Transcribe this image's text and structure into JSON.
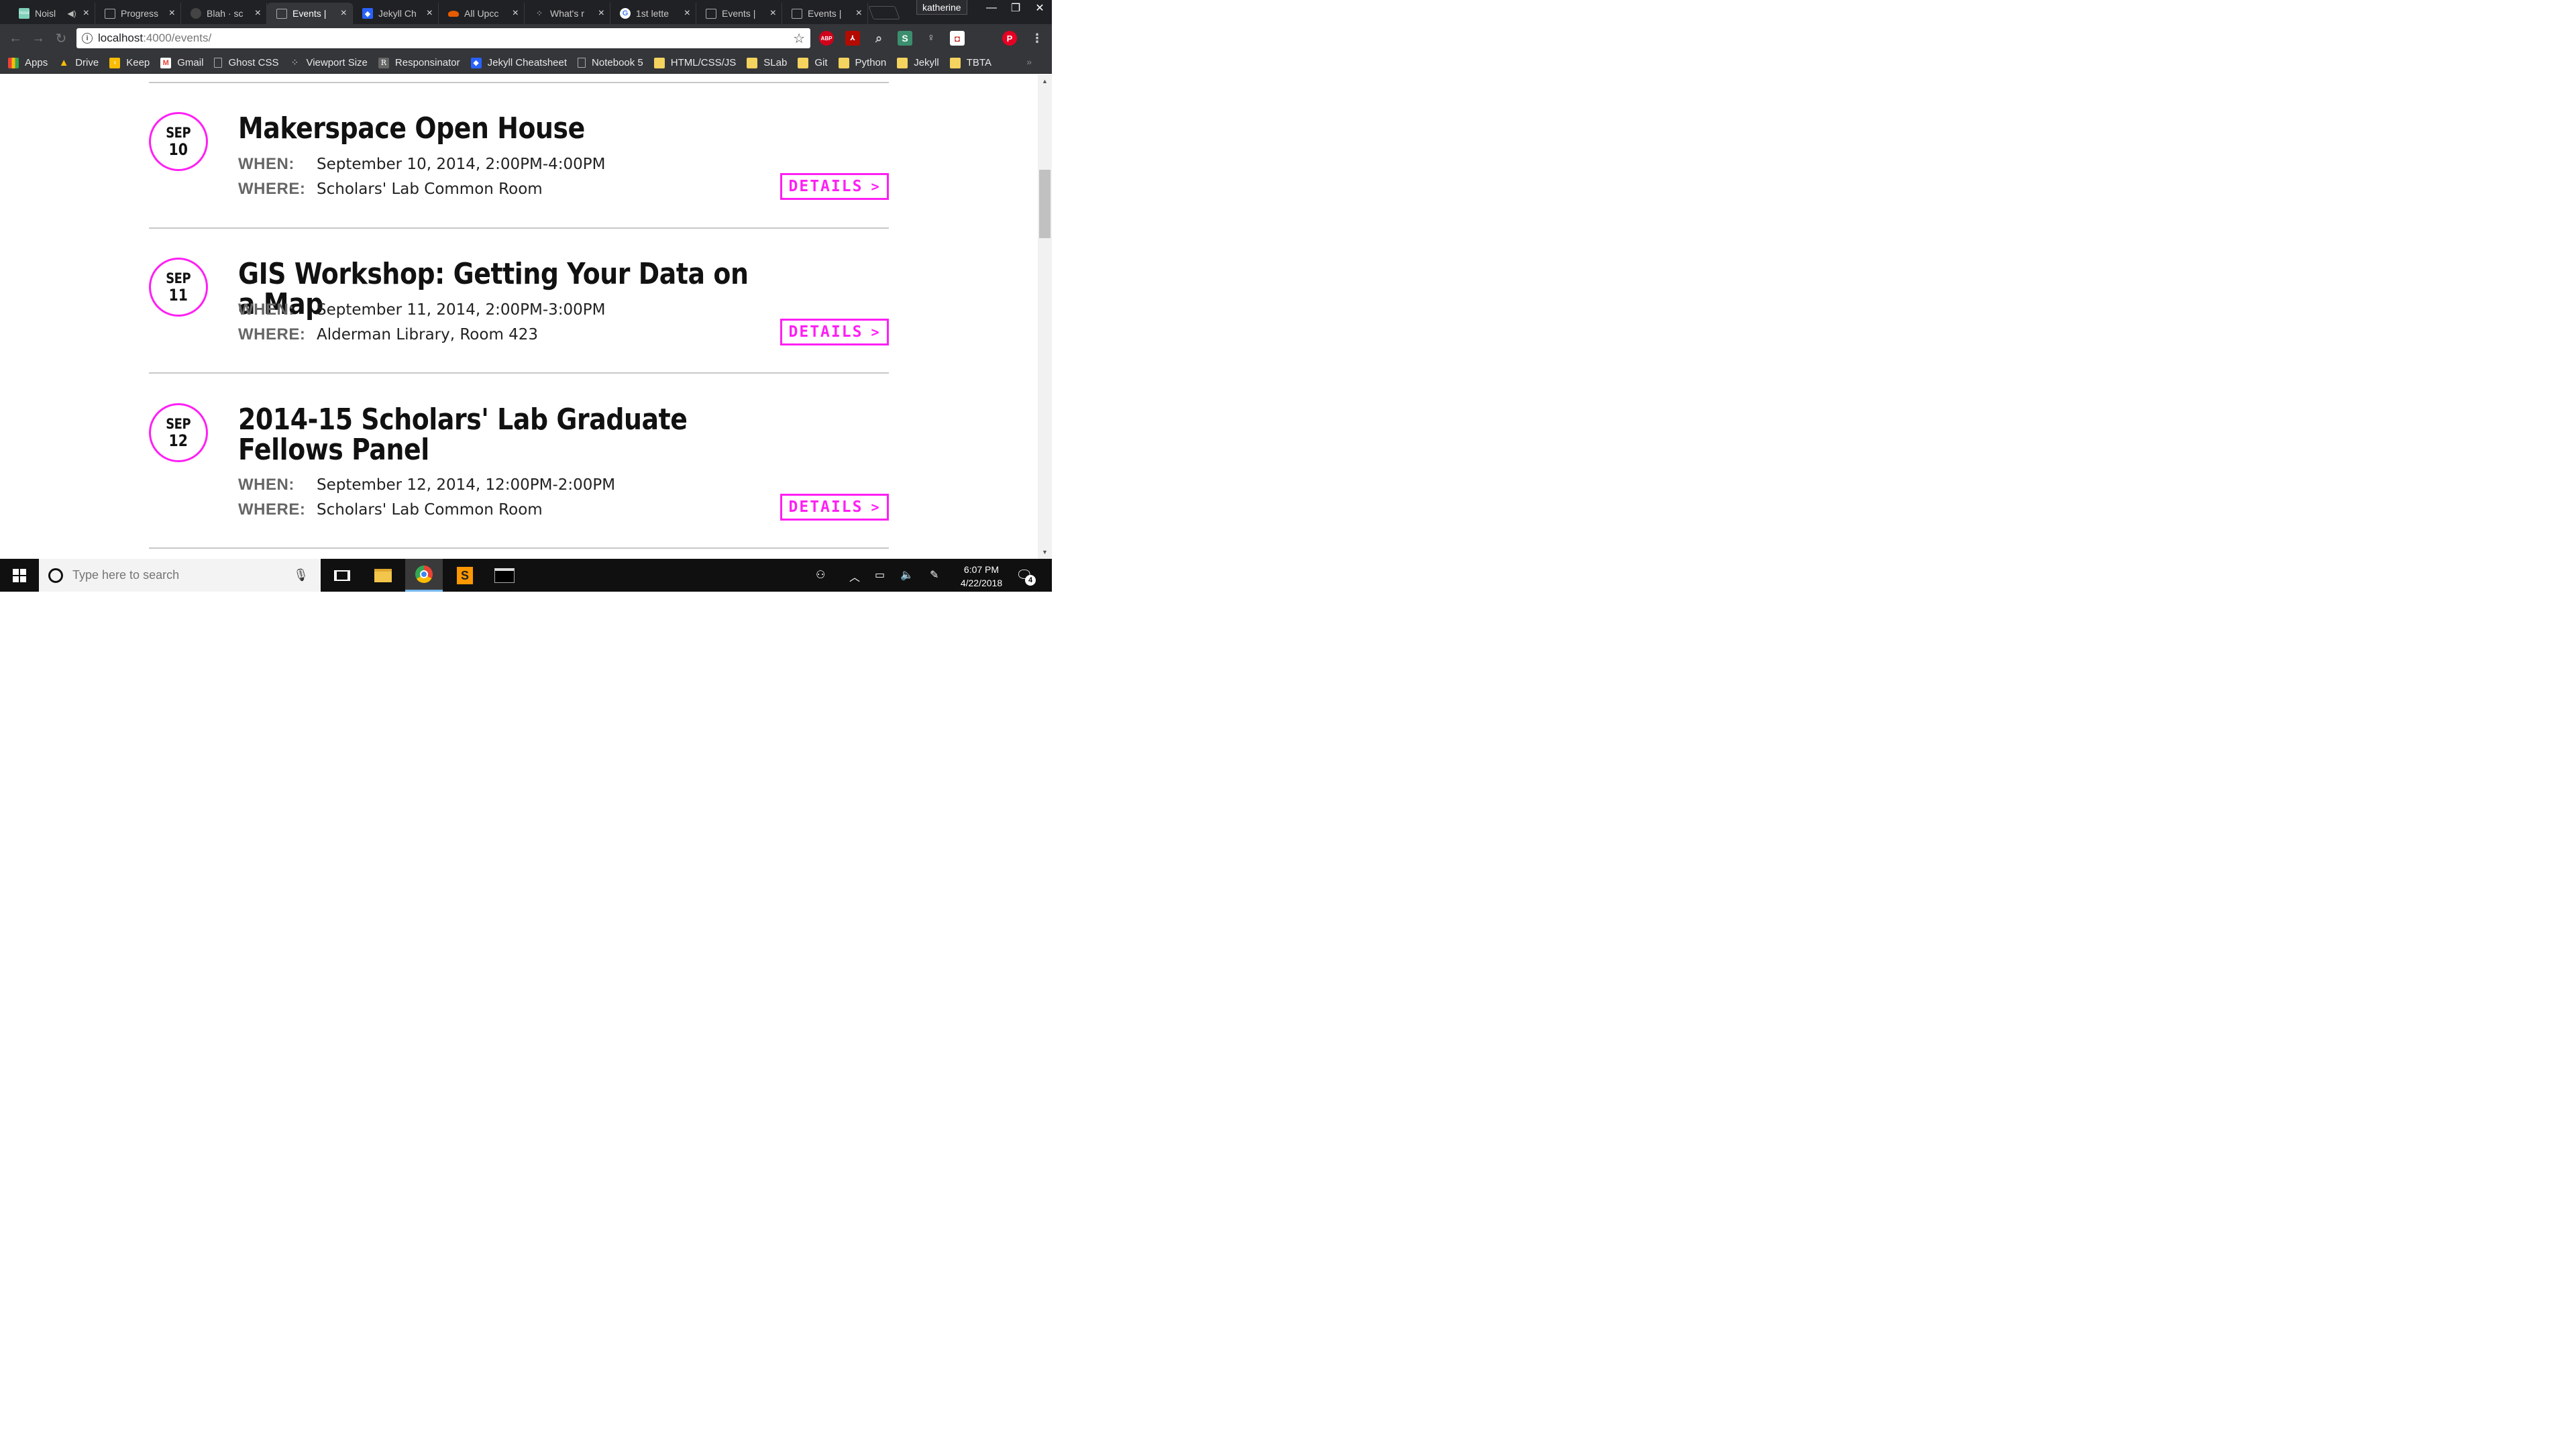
{
  "browser": {
    "tabs": [
      {
        "title": "Noisl",
        "favicon_color": "#7fd1b9",
        "favicon_text": "Noisli",
        "audio": true
      },
      {
        "title": "Progress",
        "favicon_color": "",
        "favicon_text": ""
      },
      {
        "title": "Blah · sc",
        "favicon_color": "#444",
        "favicon_text": ""
      },
      {
        "title": "Events |",
        "favicon_color": "",
        "favicon_text": "",
        "active": true
      },
      {
        "title": "Jekyll Ch",
        "favicon_color": "#2962ff",
        "favicon_text": ""
      },
      {
        "title": "All Upcc",
        "favicon_color": "#e65c00",
        "favicon_text": ""
      },
      {
        "title": "What's r",
        "favicon_color": "",
        "favicon_text": ""
      },
      {
        "title": "1st lette",
        "favicon_color": "#fff",
        "favicon_text": "G"
      },
      {
        "title": "Events |",
        "favicon_color": "",
        "favicon_text": ""
      },
      {
        "title": "Events |",
        "favicon_color": "",
        "favicon_text": ""
      }
    ],
    "profile_name": "katherine",
    "url_host": "localhost",
    "url_path": ":4000/events/",
    "extensions": [
      {
        "name": "adblock-plus",
        "text": "ABP",
        "color": "#d0021b"
      },
      {
        "name": "acrobat",
        "text": "⅄",
        "color": "#b30b00"
      },
      {
        "name": "search-lens",
        "text": "⌕",
        "color": "#555"
      },
      {
        "name": "s-extension",
        "text": "S",
        "color": "#3b8f6f"
      },
      {
        "name": "lightbulb",
        "text": "💡",
        "color": "#555"
      },
      {
        "name": "mcafee",
        "text": "M",
        "color": "#c01818"
      },
      {
        "name": "pinterest",
        "text": "P",
        "color": "#e60023"
      }
    ]
  },
  "bookmarks": [
    {
      "label": "Apps",
      "icon": "apps-grid-icon"
    },
    {
      "label": "Drive",
      "icon": "drive-icon"
    },
    {
      "label": "Keep",
      "icon": "keep-icon"
    },
    {
      "label": "Gmail",
      "icon": "gmail-icon"
    },
    {
      "label": "Ghost CSS",
      "icon": "page-icon"
    },
    {
      "label": "Viewport Size",
      "icon": "viewport-icon"
    },
    {
      "label": "Responsinator",
      "icon": "responsinator-icon"
    },
    {
      "label": "Jekyll Cheatsheet",
      "icon": "jekyll-icon"
    },
    {
      "label": "Notebook 5",
      "icon": "page-icon"
    },
    {
      "label": "HTML/CSS/JS",
      "icon": "folder-icon"
    },
    {
      "label": "SLab",
      "icon": "folder-icon"
    },
    {
      "label": "Git",
      "icon": "folder-icon"
    },
    {
      "label": "Python",
      "icon": "folder-icon"
    },
    {
      "label": "Jekyll",
      "icon": "folder-icon"
    },
    {
      "label": "TBTA",
      "icon": "folder-icon"
    }
  ],
  "page": {
    "accent_color": "#ff1ff4",
    "when_label": "WHEN:",
    "where_label": "WHERE:",
    "details_label": "DETAILS",
    "events": [
      {
        "month": "SEP",
        "day": "10",
        "title": "Makerspace Open House",
        "when": "September 10, 2014, 2:00PM-4:00PM",
        "where": "Scholars' Lab Common Room"
      },
      {
        "month": "SEP",
        "day": "11",
        "title": "GIS Workshop: Getting Your Data on a Map",
        "when": "September 11, 2014, 2:00PM-3:00PM",
        "where": "Alderman Library, Room 423"
      },
      {
        "month": "SEP",
        "day": "12",
        "title": "2014-15 Scholars' Lab Graduate Fellows Panel",
        "when": "September 12, 2014, 12:00PM-2:00PM",
        "where": "Scholars' Lab Common Room"
      }
    ]
  },
  "taskbar": {
    "search_placeholder": "Type here to search",
    "time": "6:07 PM",
    "date": "4/22/2018",
    "notification_count": "4"
  }
}
